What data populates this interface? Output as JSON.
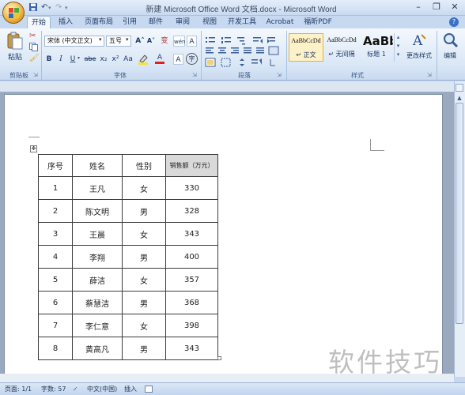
{
  "window": {
    "title": "新建 Microsoft Office Word 文档.docx - Microsoft Word",
    "minimize": "–",
    "restore": "❐",
    "close": "✕"
  },
  "quick_access": {
    "save_icon": "save-icon",
    "undo": "↶",
    "redo": "↷"
  },
  "tabs": [
    {
      "label": "开始",
      "active": true
    },
    {
      "label": "插入"
    },
    {
      "label": "页面布局"
    },
    {
      "label": "引用"
    },
    {
      "label": "邮件"
    },
    {
      "label": "审阅"
    },
    {
      "label": "视图"
    },
    {
      "label": "开发工具"
    },
    {
      "label": "Acrobat"
    },
    {
      "label": "福昕PDF"
    }
  ],
  "ribbon": {
    "clipboard": {
      "paste_label": "粘贴",
      "group_label": "剪贴板"
    },
    "font": {
      "font_name": "宋体 (中文正文)",
      "font_size": "五号",
      "group_label": "字体",
      "buttons": [
        "B",
        "I",
        "U",
        "abe",
        "x₂",
        "x²",
        "Aa"
      ],
      "grow": "A˄",
      "shrink": "A˅",
      "wen": "变",
      "wen2": "wén",
      "colored_A": "A",
      "boxed_A": "A",
      "circled_char": "字"
    },
    "paragraph": {
      "group_label": "段落"
    },
    "styles": {
      "group_label": "样式",
      "items": [
        {
          "preview": "AaBbCcDd",
          "name": "↵ 正文"
        },
        {
          "preview": "AaBbCcDd",
          "name": "↵ 无间隔"
        },
        {
          "preview": "AaBb",
          "name": "标题 1"
        }
      ],
      "change_styles": "更改样式"
    },
    "editing": {
      "label": "编辑"
    }
  },
  "table": {
    "headers": [
      "序号",
      "姓名",
      "性别",
      "销售额（万元）"
    ],
    "rows": [
      [
        "1",
        "王凡",
        "女",
        "330"
      ],
      [
        "2",
        "陈文明",
        "男",
        "328"
      ],
      [
        "3",
        "王晨",
        "女",
        "343"
      ],
      [
        "4",
        "李翔",
        "男",
        "400"
      ],
      [
        "5",
        "薛洁",
        "女",
        "357"
      ],
      [
        "6",
        "蔡慧洁",
        "男",
        "368"
      ],
      [
        "7",
        "李仁意",
        "女",
        "398"
      ],
      [
        "8",
        "黄高凡",
        "男",
        "343"
      ]
    ]
  },
  "status": {
    "page": "页面: 1/1",
    "words": "字数: 57",
    "language": "中文(中国)",
    "mode": "插入"
  },
  "watermark": "软件技巧"
}
